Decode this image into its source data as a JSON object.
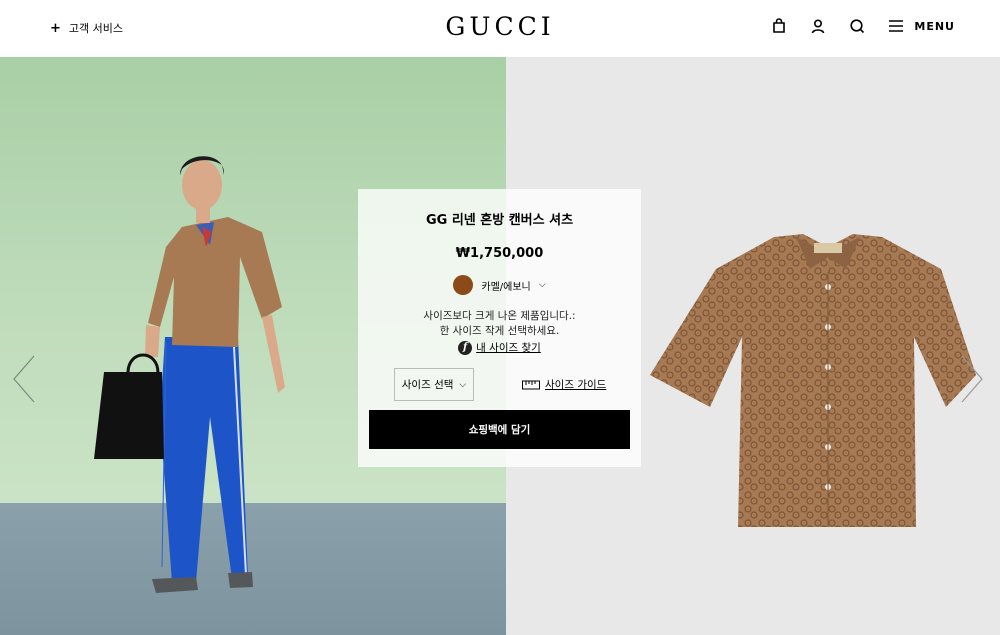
{
  "header": {
    "customer_service_plus": "+",
    "customer_service": "고객 서비스",
    "logo": "GUCCI",
    "menu_label": "MENU",
    "icons": [
      "shopping-bag-icon",
      "account-icon",
      "search-icon",
      "hamburger-menu-icon"
    ]
  },
  "product": {
    "title": "GG 리넨 혼방 캔버스 셔츠",
    "price": "₩1,750,000",
    "color": {
      "name": "카멜/에보니",
      "swatch_hex": "#8b4a17"
    },
    "size_note_line1": "사이즈보다 크게 나온 제품입니다.:",
    "size_note_line2": "한 사이즈 작게 선택하세요.",
    "find_my_size_badge": "f",
    "find_my_size": "내 사이즈 찾기",
    "size_select": "사이즈 선택",
    "size_guide": "사이즈 가이드",
    "add_to_bag": "쇼핑백에 담기"
  },
  "carousel": {
    "prev_icon": "chevron-left-icon",
    "next_icon": "chevron-right-icon"
  },
  "colors": {
    "left_backdrop": "#b8d8b4",
    "floor": "#8299a3",
    "right_backdrop": "#e8e8e8",
    "shirt": "#a77a53",
    "trousers": "#1d55c8"
  }
}
